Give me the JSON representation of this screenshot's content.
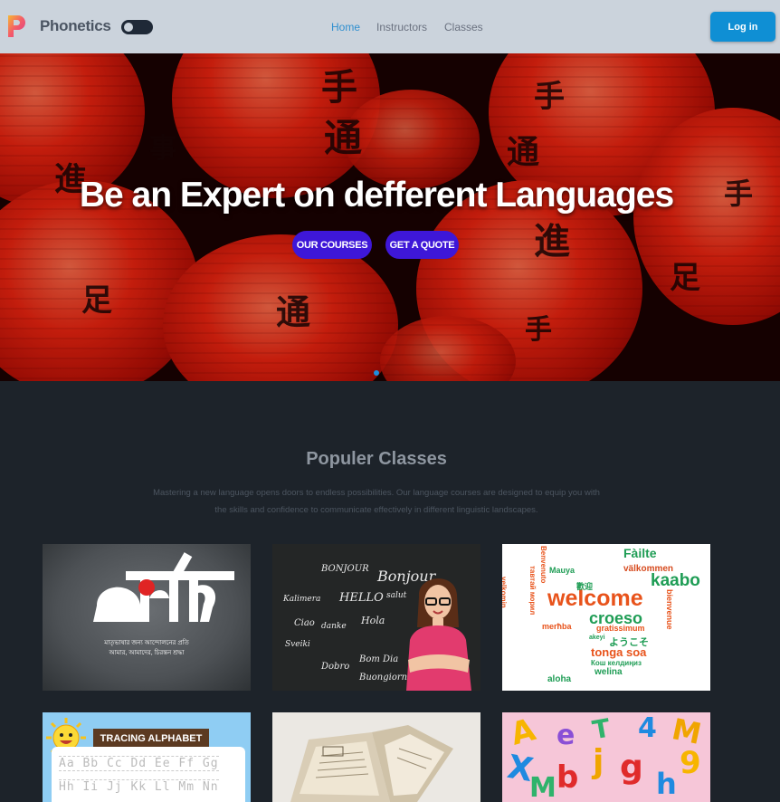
{
  "navbar": {
    "brand": "Phonetics",
    "links": [
      "Home",
      "Instructors",
      "Classes"
    ],
    "login_label": "Log in",
    "accent": "#0f8fd4"
  },
  "hero": {
    "title": "Be an Expert on defferent Languages",
    "primary_button": "OUR COURSES",
    "secondary_button": "GET A QUOTE",
    "button_color": "#3e17d8"
  },
  "classes": {
    "title": "Populer Classes",
    "description": "Mastering a new language opens doors to endless possibilities. Our language courses are designed to equip you with the skills and confidence to communicate effectively in different linguistic landscapes.",
    "cards": [
      {
        "id": "bangla",
        "title_art": "বাংলা",
        "caption_line1": "মাতৃভাষার জন্য আন্দোলনের প্রতি",
        "caption_line2": "আমার, আমাদের, চিরন্তন শ্রদ্ধা"
      },
      {
        "id": "chalkboard",
        "words": [
          "BONJOUR",
          "Bonjour",
          "HELLO",
          "Kalimera",
          "salut",
          "Ciao",
          "Hola",
          "danke",
          "Sveiki",
          "Dobro",
          "Bom Dia",
          "Buongiorno"
        ]
      },
      {
        "id": "welcome-cloud",
        "words": [
          "welcome",
          "kaabo",
          "croeso",
          "Fàilte",
          "välkommen",
          "Mauya",
          "tonga soa",
          "gratissimum",
          "welina",
          "ようこそ",
          "merħba",
          "aloha",
          "velkomin",
          "akeyi",
          "bienvenue",
          "歡迎",
          "Кош келдиңиз",
          "Benvenuto",
          "тавтай морил"
        ]
      },
      {
        "id": "tracing",
        "label": "TRACING ALPHABET",
        "row1": "Aa Bb Cc Dd Ee Ff Gg",
        "row2": "Hh Ii Jj Kk Ll Mm Nn"
      },
      {
        "id": "old-books"
      },
      {
        "id": "alphabet-magnets",
        "letters": [
          "A",
          "e",
          "X",
          "4",
          "M",
          "j",
          "g",
          "9",
          "b",
          "T",
          "M",
          "h"
        ]
      }
    ]
  }
}
